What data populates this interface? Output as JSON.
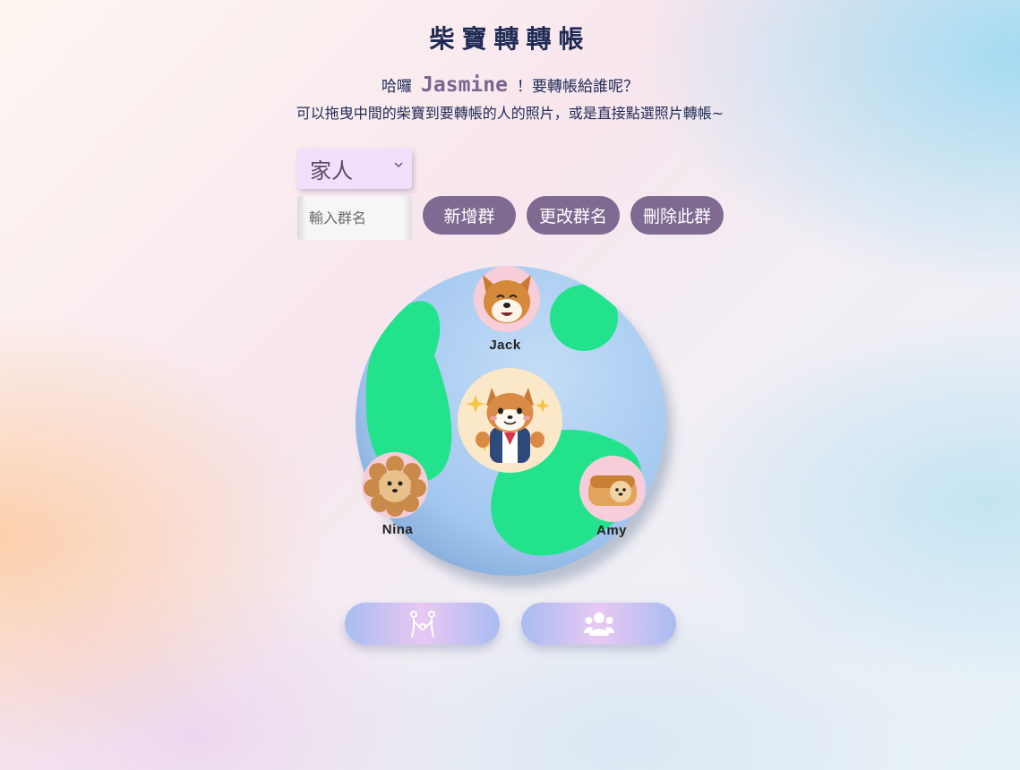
{
  "title": "柴寶轉轉帳",
  "greeting": {
    "prefix": "哈囉",
    "username": "Jasmine",
    "suffix": "！要轉帳給誰呢？"
  },
  "instruction": "可以拖曳中間的柴寶到要轉帳的人的照片，或是直接點選照片轉帳~",
  "group_select": {
    "selected": "家人"
  },
  "group_name_input": {
    "placeholder": "輸入群名",
    "value": ""
  },
  "buttons": {
    "add_group": "新增群",
    "rename_group": "更改群名",
    "delete_group": "刪除此群"
  },
  "contacts": [
    {
      "name": "Jack"
    },
    {
      "name": "Nina"
    },
    {
      "name": "Amy"
    }
  ],
  "bottom_nav": [
    {
      "icon": "transfer-people-icon"
    },
    {
      "icon": "group-icon"
    }
  ],
  "colors": {
    "accent": "#7f6a92",
    "title": "#1f2a55",
    "globe_water": "#a6cbf1",
    "globe_land": "#22e38c"
  }
}
